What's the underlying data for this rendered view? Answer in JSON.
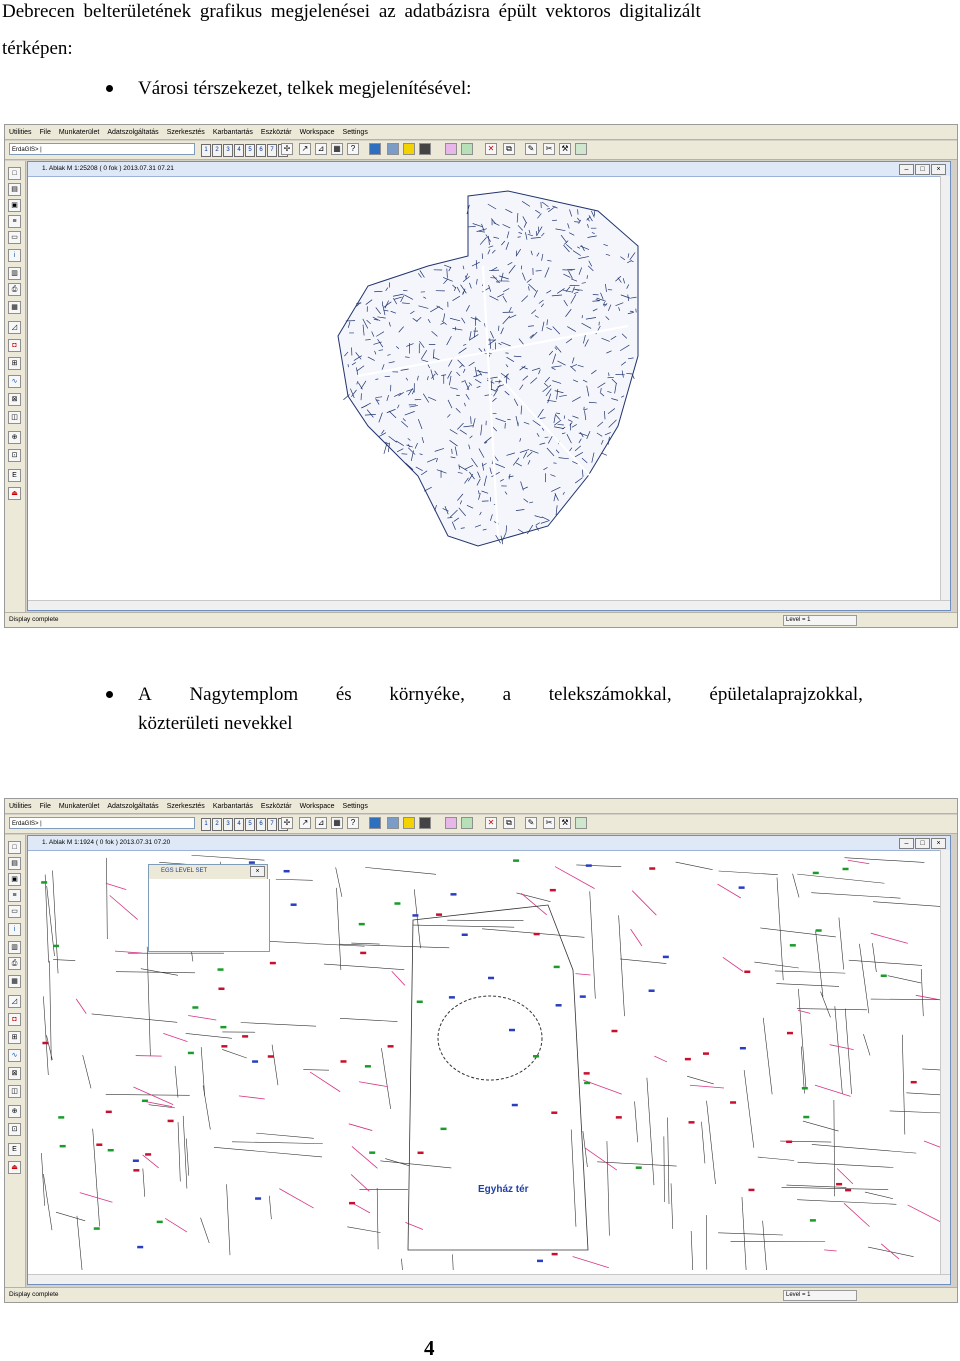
{
  "intro": {
    "line1": "Debrecen belterületének grafikus megjelenései az adatbázisra épült vektoros digitalizált",
    "line2": "térképen:"
  },
  "bullet1": "Városi térszekezet, telkek megjelenítésével:",
  "bullet2": {
    "line1_words": [
      "A",
      "Nagytemplom",
      "és",
      "környéke,",
      "a",
      "telekszámokkal,",
      "épületalaprajzokkal,"
    ],
    "line2": "közterületi nevekkel"
  },
  "app": {
    "menu": [
      "Utilities",
      "File",
      "Munkaterület",
      "Adatszolgáltatás",
      "Szerkesztés",
      "Karbantartás",
      "Eszköztár",
      "Workspace",
      "Settings"
    ],
    "command_prompt": "ErdaGIS> |",
    "view_numbers": [
      "1",
      "2",
      "3",
      "4",
      "5",
      "6",
      "7",
      "8"
    ],
    "status": "Display complete",
    "level": "Level = 1",
    "minimize_icon": "minimize-icon",
    "maximize_icon": "maximize-icon",
    "close_icon": "close-icon"
  },
  "screens": [
    {
      "window_title": "1. Ablak  M 1:25208   ( 0 fok )  2013.07.31 07.21"
    },
    {
      "window_title": "1. Ablak  M 1:1924   ( 0 fok )  2013.07.31 07.20",
      "dialog_title": "EGS LEVEL SET",
      "street_label": "Egyház tér"
    }
  ],
  "colors": {
    "parcel_lines": "#20336e",
    "plot_numbers": "#c8102e",
    "building_lines": "#d63384",
    "street_label": "#1f3fa8"
  },
  "page_number": "4"
}
